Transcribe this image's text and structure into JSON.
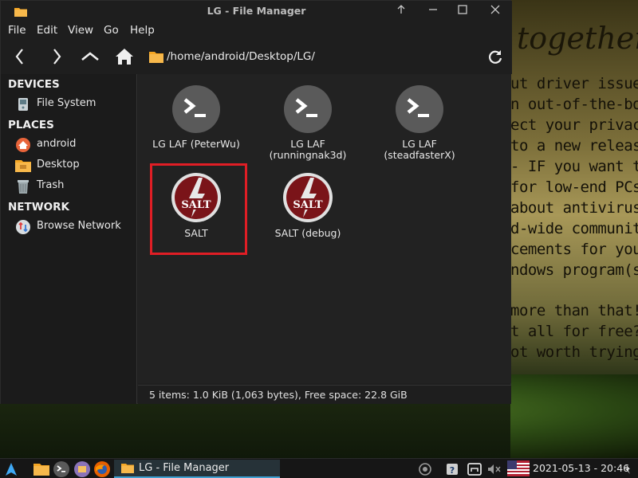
{
  "window": {
    "title": "LG - File Manager"
  },
  "menu": [
    "File",
    "Edit",
    "View",
    "Go",
    "Help"
  ],
  "path": "/home/android/Desktop/LG/",
  "sidebar": {
    "devices_header": "DEVICES",
    "places_header": "PLACES",
    "network_header": "NETWORK",
    "items": [
      {
        "label": "File System",
        "icon": "drive-icon"
      },
      {
        "label": "android",
        "icon": "home-folder-icon"
      },
      {
        "label": "Desktop",
        "icon": "desktop-folder-icon"
      },
      {
        "label": "Trash",
        "icon": "trash-icon"
      },
      {
        "label": "Browse Network",
        "icon": "network-icon"
      }
    ]
  },
  "files": [
    {
      "label": "LG LAF (PeterWu)",
      "icon": "terminal-icon"
    },
    {
      "label": "LG LAF\n(runningnak3d)",
      "label_line1": "LG LAF",
      "label_line2": "(runningnak3d)",
      "icon": "terminal-icon"
    },
    {
      "label_line1": "LG LAF",
      "label_line2": "(steadfasterX)",
      "icon": "terminal-icon"
    },
    {
      "label": "SALT",
      "icon": "salt-icon",
      "highlighted": true
    },
    {
      "label": "SALT (debug)",
      "icon": "salt-icon"
    }
  ],
  "status": "5 items: 1.0 KiB (1,063 bytes), Free space: 22.8 GiB",
  "taskbar": {
    "active_task": "LG - File Manager",
    "clock": "2021-05-13 - 20:46"
  },
  "wallpaper": {
    "heading": "together",
    "lines": [
      "ut driver issues",
      "n out-of-the-box",
      "ect your privacy",
      "to a new release",
      "- IF you want to",
      "for low-end PCs",
      "about antivirus",
      "d-wide community",
      "cements for your",
      "ndows program(s)",
      "",
      "more than that!",
      "t all for free?",
      "ot worth trying?"
    ]
  },
  "colors": {
    "accent": "#e01e25",
    "folder": "#f5a623",
    "highlight_border": "#e01e25"
  }
}
